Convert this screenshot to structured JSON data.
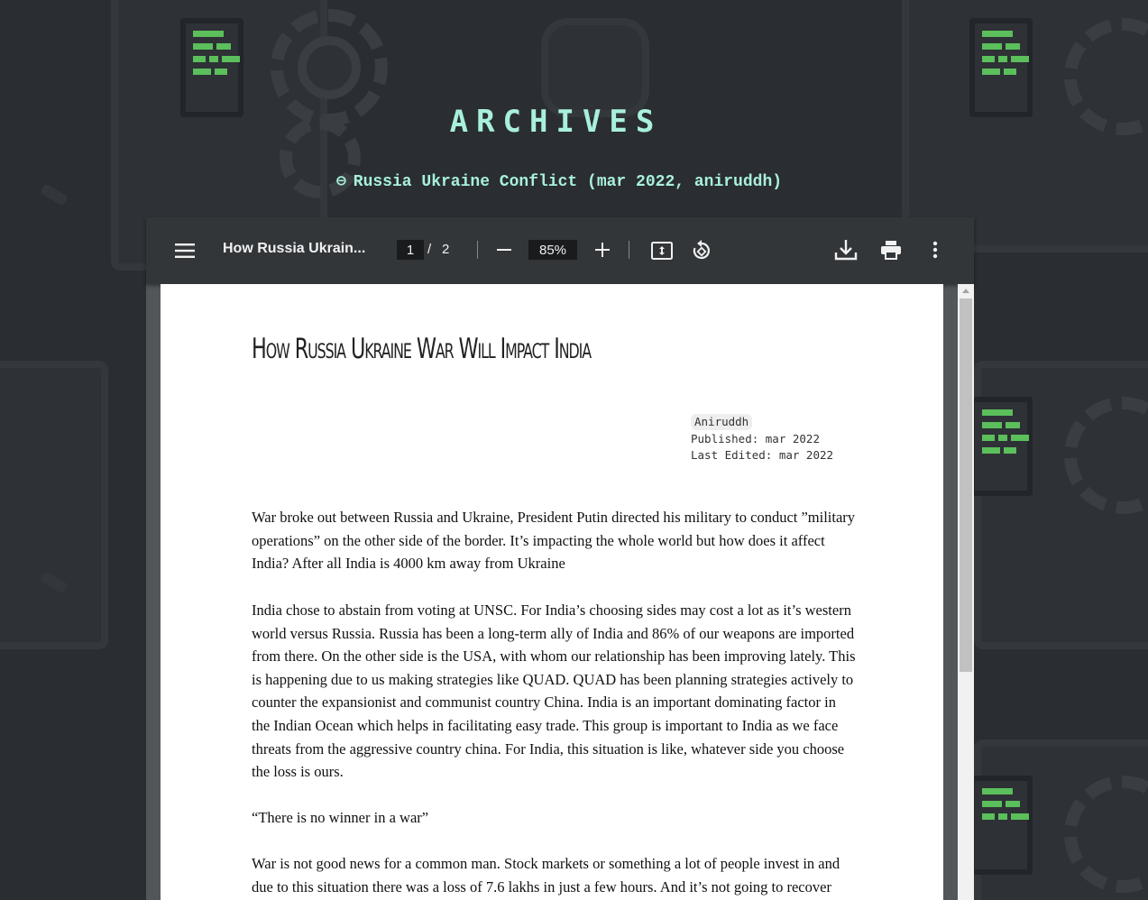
{
  "site": {
    "title": "ARCHIVES",
    "entry_symbol": "⊖",
    "entry_label": "Russia Ukraine Conflict (mar 2022, aniruddh)"
  },
  "viewer": {
    "doc_title": "How Russia Ukrain...",
    "current_page": "1",
    "page_separator": "/",
    "total_pages": "2",
    "zoom": "85%",
    "icons": [
      "menu-icon",
      "zoom-out-icon",
      "zoom-in-icon",
      "fit-page-icon",
      "rotate-icon",
      "download-icon",
      "print-icon",
      "more-options-icon"
    ]
  },
  "document": {
    "heading": "How Russia Ukraine War Will Impact India",
    "author": "Aniruddh",
    "published": "Published: mar 2022",
    "last_edited": "Last Edited: mar 2022",
    "paragraphs": [
      "War broke out between Russia and Ukraine, President Putin directed his military to conduct ”military operations” on the other side of the border. It’s impacting the whole world but how does it affect India? After all India is 4000 km away from Ukraine",
      "India chose to abstain from voting at UNSC. For India’s choosing sides may cost a lot as it’s western world versus Russia. Russia has been a long-term ally of India and 86% of our weapons are imported from there. On the other side is the USA, with whom our relationship has been improving lately. This is happening due to us making strategies like QUAD. QUAD has been planning strategies actively to counter the expansionist and communist country China. India is an important dominating factor in the Indian Ocean which helps in facilitating easy trade. This group is important to India as we face threats from the aggressive country china. For India, this situation is like, whatever side you choose the loss is ours.",
      "“There is no winner in a war”",
      "War is not good news for a common man. Stock markets or something a lot of people invest in and due to this situation there was a loss of 7.6 lakhs in just a few hours. And it’s not going to recover"
    ]
  },
  "colors": {
    "background": "#2a2d31",
    "accent_text": "#a8f0dc",
    "terminal_green": "#5bbf5b",
    "toolbar": "#323639"
  }
}
